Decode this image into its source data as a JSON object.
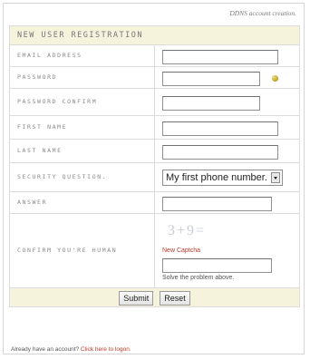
{
  "caption": "DDNS account creation.",
  "form": {
    "title": "NEW USER REGISTRATION",
    "fields": {
      "email": {
        "label": "EMAIL ADDRESS",
        "value": ""
      },
      "password": {
        "label": "PASSWORD",
        "value": ""
      },
      "password_confirm": {
        "label": "PASSWORD CONFIRM",
        "value": ""
      },
      "first_name": {
        "label": "FIRST NAME",
        "value": ""
      },
      "last_name": {
        "label": "LAST NAME",
        "value": ""
      },
      "security_question": {
        "label": "SECURITY QUESTION.",
        "selected": "My first phone number."
      },
      "answer": {
        "label": "ANSWER",
        "value": ""
      },
      "confirm_human": {
        "label": "CONFIRM YOU'RE HUMAN",
        "captcha_text": "3+9=",
        "new_captcha_label": "New Captcha",
        "instruction": "Solve the problem above.",
        "value": ""
      }
    },
    "buttons": {
      "submit": "Submit",
      "reset": "Reset"
    }
  },
  "footer": {
    "prompt": "Already have an account?",
    "link": "Click here to logon."
  },
  "icons": {
    "password_help": "help-dot-icon",
    "select_arrow": "chevron-down-icon"
  }
}
